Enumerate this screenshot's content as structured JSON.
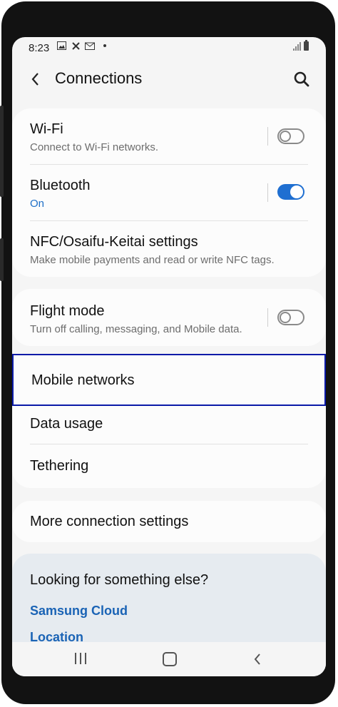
{
  "status_bar": {
    "time": "8:23"
  },
  "header": {
    "title": "Connections"
  },
  "group1": {
    "wifi": {
      "title": "Wi-Fi",
      "subtitle": "Connect to Wi-Fi networks.",
      "enabled": false
    },
    "bluetooth": {
      "title": "Bluetooth",
      "subtitle": "On",
      "enabled": true
    },
    "nfc": {
      "title": "NFC/Osaifu-Keitai settings",
      "subtitle": "Make mobile payments and read or write NFC tags."
    }
  },
  "group2": {
    "flight_mode": {
      "title": "Flight mode",
      "subtitle": "Turn off calling, messaging, and Mobile data.",
      "enabled": false
    }
  },
  "group3": {
    "mobile_networks": {
      "title": "Mobile networks"
    },
    "data_usage": {
      "title": "Data usage"
    },
    "tethering": {
      "title": "Tethering"
    }
  },
  "group4": {
    "more": {
      "title": "More connection settings"
    }
  },
  "help": {
    "title": "Looking for something else?",
    "links": [
      "Samsung Cloud",
      "Location"
    ]
  },
  "colors": {
    "accent": "#1f6fd1",
    "highlight": "#0a1aa8",
    "link": "#1a63b5"
  }
}
